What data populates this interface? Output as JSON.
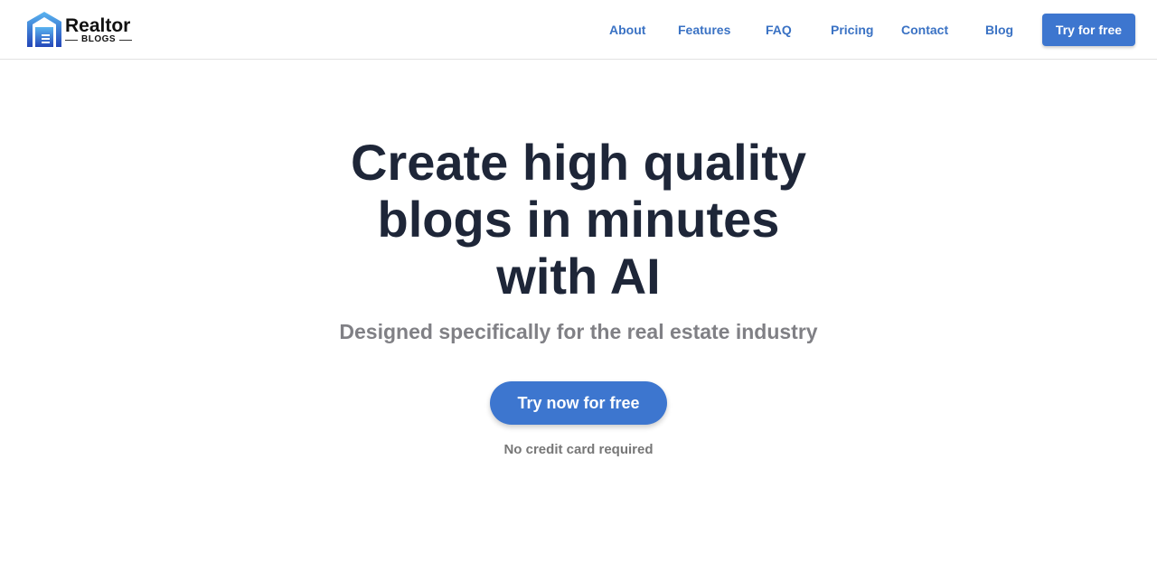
{
  "logo": {
    "main": "Realtor",
    "sub": "BLOGS",
    "icon": "house-garage-icon"
  },
  "nav": {
    "items": [
      {
        "label": "About"
      },
      {
        "label": "Features"
      },
      {
        "label": "FAQ"
      },
      {
        "label": "Pricing"
      },
      {
        "label": "Contact"
      },
      {
        "label": "Blog"
      }
    ],
    "cta_label": "Try for free"
  },
  "hero": {
    "title": "Create high quality blogs in minutes with AI",
    "subtitle": "Designed specifically for the real estate industry",
    "cta_label": "Try now for free",
    "note": "No credit card required"
  },
  "colors": {
    "accent": "#3d76cf",
    "heading": "#1e2638",
    "nav_link": "#3a72c4"
  }
}
